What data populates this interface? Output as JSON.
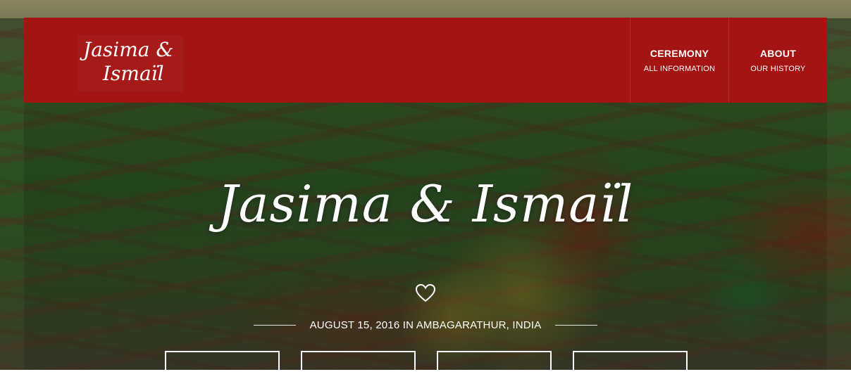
{
  "logo": {
    "line1": "Jasima &",
    "line2": "Ismaïl"
  },
  "nav": [
    {
      "title": "CEREMONY",
      "subtitle": "ALL INFORMATION"
    },
    {
      "title": "ABOUT",
      "subtitle": "OUR HISTORY"
    }
  ],
  "hero": {
    "title": "Jasima & Ismaïl",
    "heart_icon": "heart-outline-icon",
    "date_location": "AUGUST 15, 2016 IN AMBAGARATHUR, INDIA"
  },
  "buttons": [
    {
      "label": ""
    },
    {
      "label": ""
    },
    {
      "label": ""
    },
    {
      "label": ""
    }
  ],
  "colors": {
    "header": "#aa1212",
    "text": "#ffffff"
  }
}
